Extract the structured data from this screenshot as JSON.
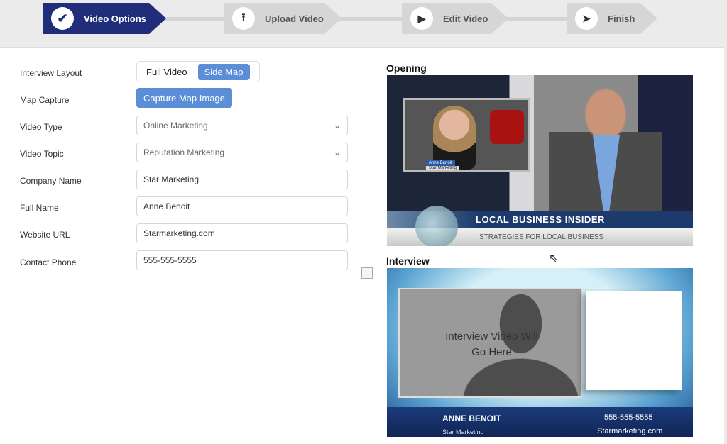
{
  "wizard": {
    "steps": [
      {
        "label": "Video Options",
        "icon": "check-icon",
        "active": true
      },
      {
        "label": "Upload Video",
        "icon": "upload-icon",
        "active": false
      },
      {
        "label": "Edit Video",
        "icon": "play-icon",
        "active": false
      },
      {
        "label": "Finish",
        "icon": "send-icon",
        "active": false
      }
    ],
    "active_color": "#1f2d7b"
  },
  "form": {
    "interview_layout": {
      "label": "Interview Layout",
      "options": [
        "Full Video",
        "Side Map"
      ],
      "selected": "Side Map"
    },
    "map_capture": {
      "label": "Map Capture",
      "button": "Capture Map Image"
    },
    "video_type": {
      "label": "Video Type",
      "value": "Online Marketing"
    },
    "video_topic": {
      "label": "Video Topic",
      "value": "Reputation Marketing"
    },
    "company_name": {
      "label": "Company Name",
      "value": "Star Marketing"
    },
    "full_name": {
      "label": "Full Name",
      "value": "Anne Benoit"
    },
    "website_url": {
      "label": "Website URL",
      "value": "Starmarketing.com"
    },
    "contact_phone": {
      "label": "Contact Phone",
      "value": "555-555-5555"
    }
  },
  "preview": {
    "opening": {
      "title": "Opening",
      "inset_name": "Anne Benoit",
      "inset_company": "Star Marketing",
      "headline": "LOCAL BUSINESS INSIDER",
      "subheadline": "STRATEGIES FOR LOCAL BUSINESS"
    },
    "interview": {
      "title": "Interview",
      "placeholder_line1": "Interview Video Will",
      "placeholder_line2": "Go Here",
      "name": "ANNE BENOIT",
      "company": "Star Marketing",
      "phone": "555-555-5555",
      "website": "Starmarketing.com"
    }
  },
  "accent_color": "#5b8ed6"
}
